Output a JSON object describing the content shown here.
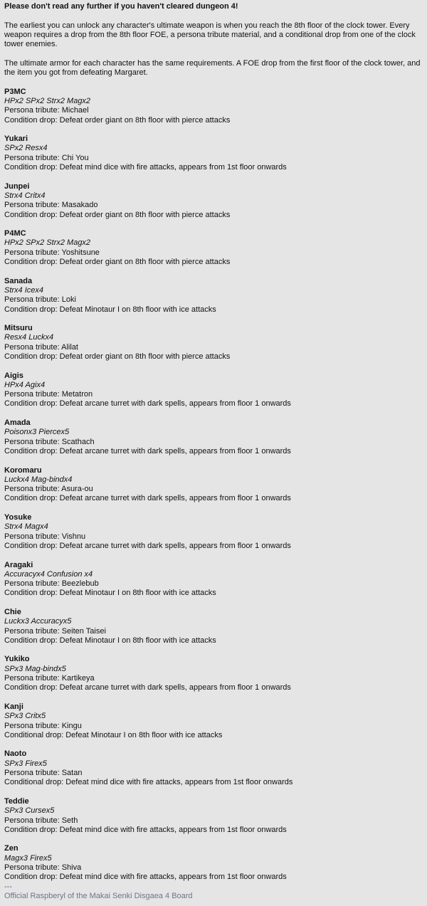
{
  "warning": "Please don't read any further if you haven't cleared dungeon 4!",
  "intro": [
    "The earliest you can unlock any character's ultimate weapon is when you reach the 8th floor of the clock tower. Every weapon requires a drop from the 8th floor FOE, a persona tribute material, and a conditional drop from one of the clock tower enemies.",
    "The ultimate armor for each character has the same requirements. A FOE drop from the first floor of the clock tower, and the item you got from defeating Margaret."
  ],
  "entries": [
    {
      "name": "P3MC",
      "skills": "HPx2 SPx2 Strx2 Magx2",
      "tribute": "Persona tribute: Michael",
      "drop": "Condition drop: Defeat order giant on 8th floor with pierce attacks"
    },
    {
      "name": "Yukari",
      "skills": "SPx2 Resx4",
      "tribute": "Persona tribute: Chi You",
      "drop": "Condition drop: Defeat mind dice with fire attacks, appears from 1st floor onwards"
    },
    {
      "name": "Junpei",
      "skills": "Strx4 Critx4",
      "tribute": "Persona tribute: Masakado",
      "drop": "Condition drop: Defeat order giant on 8th floor with pierce attacks"
    },
    {
      "name": "P4MC",
      "skills": "HPx2 SPx2 Strx2 Magx2",
      "tribute": "Persona tribute: Yoshitsune",
      "drop": "Condition drop: Defeat order giant on 8th floor with pierce attacks"
    },
    {
      "name": "Sanada",
      "skills": "Strx4 Icex4",
      "tribute": "Persona tribute: Loki",
      "drop": "Condition drop: Defeat Minotaur I on 8th floor with ice attacks"
    },
    {
      "name": "Mitsuru",
      "skills": "Resx4 Luckx4",
      "tribute": "Persona tribute: Alilat",
      "drop": "Condition drop: Defeat order giant on 8th floor with pierce attacks"
    },
    {
      "name": "Aigis",
      "skills": "HPx4 Agix4",
      "tribute": "Persona tribute: Metatron",
      "drop": "Condition drop: Defeat arcane turret with dark spells, appears from floor 1 onwards"
    },
    {
      "name": "Amada",
      "skills": "Poisonx3 Piercex5",
      "tribute": "Persona tribute: Scathach",
      "drop": "Condition drop: Defeat arcane turret with dark spells, appears from floor 1 onwards"
    },
    {
      "name": "Koromaru",
      "skills": "Luckx4 Mag-bindx4",
      "tribute": "Persona tribute: Asura-ou",
      "drop": "Condition drop: Defeat arcane turret with dark spells, appears from floor 1 onwards"
    },
    {
      "name": "Yosuke",
      "skills": "Strx4 Magx4",
      "tribute": "Persona tribute: Vishnu",
      "drop": "Condition drop: Defeat arcane turret with dark spells, appears from floor 1 onwards"
    },
    {
      "name": "Aragaki",
      "skills": "Accuracyx4 Confusion x4",
      "tribute": "Persona tribute: Beezlebub",
      "drop": "Condition drop: Defeat Minotaur I on 8th floor with ice attacks"
    },
    {
      "name": "Chie",
      "skills": "Luckx3 Accuracyx5",
      "tribute": "Persona tribute: Seiten Taisei",
      "drop": "Condition drop: Defeat Minotaur I on 8th floor with ice attacks"
    },
    {
      "name": "Yukiko",
      "skills": "SPx3 Mag-bindx5",
      "tribute": "Persona tribute: Kartikeya",
      "drop": "Condition drop: Defeat arcane turret with dark spells, appears from floor 1 onwards"
    },
    {
      "name": "Kanji",
      "skills": "SPx3 Critx5",
      "tribute": "Persona tribute: Kingu",
      "drop": "Conditional drop: Defeat Minotaur I on 8th floor with ice attacks"
    },
    {
      "name": "Naoto",
      "skills": "SPx3 Firex5",
      "tribute": "Persona tribute: Satan",
      "drop": "Conditional drop: Defeat mind dice with fire attacks, appears from 1st floor onwards"
    },
    {
      "name": "Teddie",
      "skills": "SPx3 Cursex5",
      "tribute": "Persona tribute: Seth",
      "drop": "Condition drop: Defeat mind dice with fire attacks, appears from 1st floor onwards"
    },
    {
      "name": "Zen",
      "skills": "Magx3 Firex5",
      "tribute": "Persona tribute: Shiva",
      "drop": "Condition drop: Defeat mind dice with fire attacks, appears from 1st floor onwards"
    }
  ],
  "signature_separator": "---",
  "signature": "Official Raspberyl of the Makai Senki Disgaea 4 Board"
}
